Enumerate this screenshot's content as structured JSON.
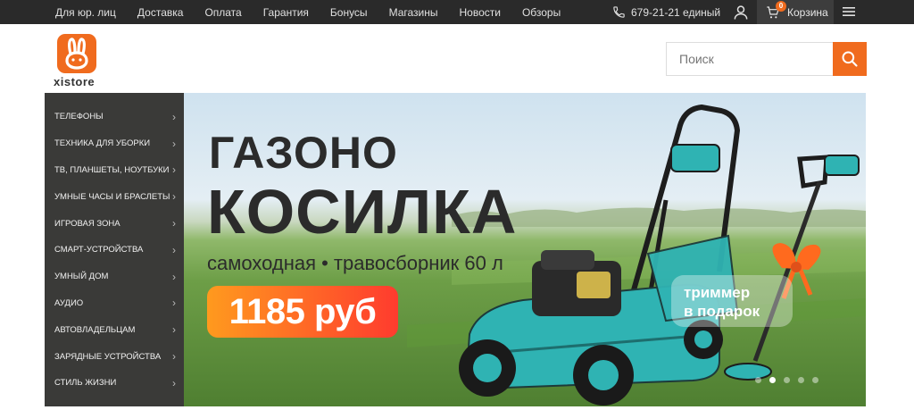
{
  "topbar": {
    "links": [
      "Для юр. лиц",
      "Доставка",
      "Оплата",
      "Гарантия",
      "Бонусы",
      "Магазины",
      "Новости",
      "Обзоры"
    ],
    "phone": "679-21-21 единый",
    "cart_count": "0",
    "cart_label": "Корзина"
  },
  "logo": {
    "text": "xistore"
  },
  "search": {
    "placeholder": "Поиск"
  },
  "sidebar": {
    "items": [
      "ТЕЛЕФОНЫ",
      "ТЕХНИКА ДЛЯ УБОРКИ",
      "ТВ, ПЛАНШЕТЫ, НОУТБУКИ",
      "УМНЫЕ ЧАСЫ И БРАСЛЕТЫ",
      "ИГРОВАЯ ЗОНА",
      "СМАРТ-УСТРОЙСТВА",
      "УМНЫЙ ДОМ",
      "АУДИО",
      "АВТОВЛАДЕЛЬЦАМ",
      "ЗАРЯДНЫЕ УСТРОЙСТВА",
      "СТИЛЬ ЖИЗНИ"
    ]
  },
  "banner": {
    "title_line1": "ГАЗОНО",
    "title_line2": "КОСИЛКА",
    "subtitle": "самоходная • травосборник 60 л",
    "price": "1185 руб",
    "gift_line1": "триммер",
    "gift_line2": "в подарок",
    "slides": 5,
    "active_slide": 1
  },
  "colors": {
    "accent": "#f06b1e",
    "topbar": "#2a2a2a",
    "sidebar": "#3a3a38"
  }
}
